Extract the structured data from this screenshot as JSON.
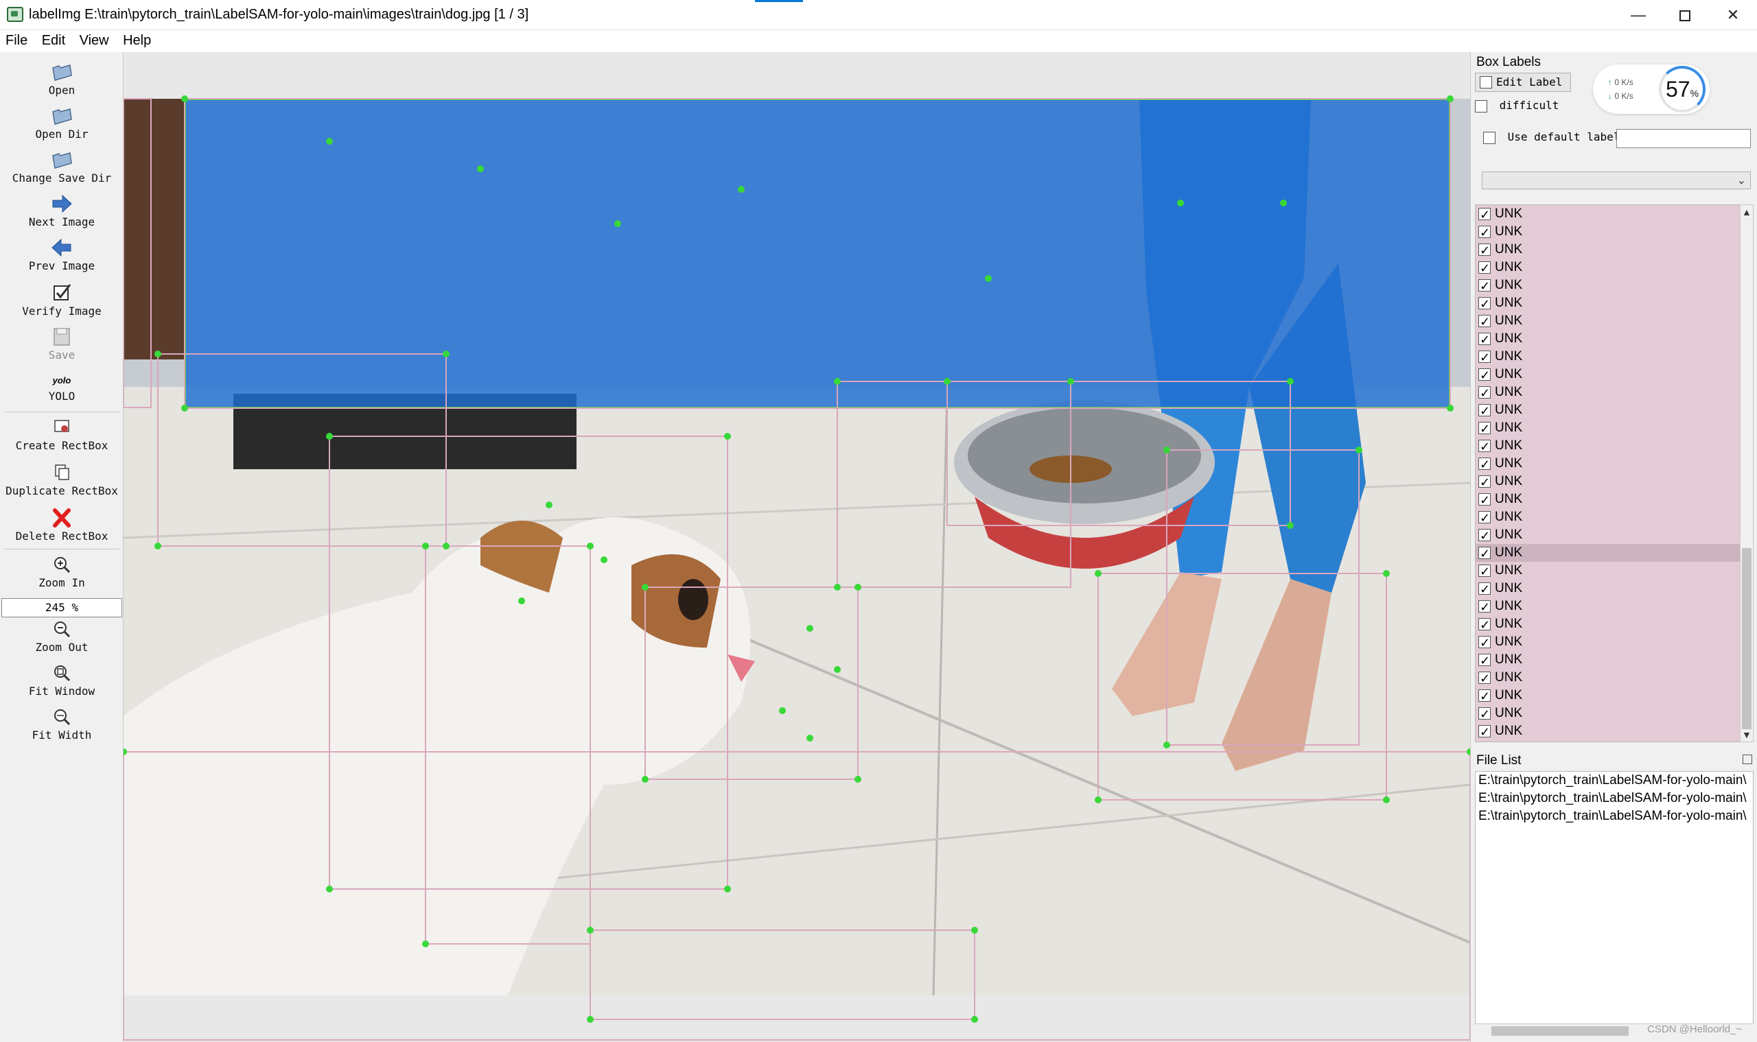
{
  "window": {
    "title": "labelImg E:\\train\\pytorch_train\\LabelSAM-for-yolo-main\\images\\train\\dog.jpg [1 / 3]",
    "min": "—",
    "close": "✕"
  },
  "menu": [
    "File",
    "Edit",
    "View",
    "Help"
  ],
  "toolbar": {
    "open": "Open",
    "open_dir": "Open Dir",
    "change_save_dir": "Change Save Dir",
    "next_image": "Next Image",
    "prev_image": "Prev Image",
    "verify_image": "Verify Image",
    "save": "Save",
    "yolo_icon_text": "yolo",
    "yolo": "YOLO",
    "create_rectbox": "Create RectBox",
    "duplicate_rectbox": "Duplicate RectBox",
    "delete_rectbox": "Delete RectBox",
    "zoom_in": "Zoom In",
    "zoom_value": "245 %",
    "zoom_out": "Zoom Out",
    "fit_window": "Fit Window",
    "fit_width": "Fit Width"
  },
  "dock": {
    "box_labels_title": "Box Labels",
    "edit_label": "Edit Label",
    "difficult": "difficult",
    "use_default_label": "Use default label",
    "default_label_value": "",
    "labels": [
      "UNK",
      "UNK",
      "UNK",
      "UNK",
      "UNK",
      "UNK",
      "UNK",
      "UNK",
      "UNK",
      "UNK",
      "UNK",
      "UNK",
      "UNK",
      "UNK",
      "UNK",
      "UNK",
      "UNK",
      "UNK",
      "UNK",
      "UNK",
      "UNK",
      "UNK",
      "UNK",
      "UNK",
      "UNK",
      "UNK",
      "UNK",
      "UNK",
      "UNK",
      "UNK"
    ],
    "selected_label_index": 19,
    "file_list_title": "File List",
    "files": [
      "E:\\train\\pytorch_train\\LabelSAM-for-yolo-main\\",
      "E:\\train\\pytorch_train\\LabelSAM-for-yolo-main\\",
      "E:\\train\\pytorch_train\\LabelSAM-for-yolo-main\\"
    ]
  },
  "net_widget": {
    "up": "0  K/s",
    "down": "0  K/s",
    "percent": "57",
    "percent_unit": "%"
  },
  "watermark": "CSDN @Helloorld_~",
  "colors": {
    "selection_box": "#1e6ed2",
    "vertex": "#38d838",
    "label_list_bg": "#e3ccd6"
  }
}
